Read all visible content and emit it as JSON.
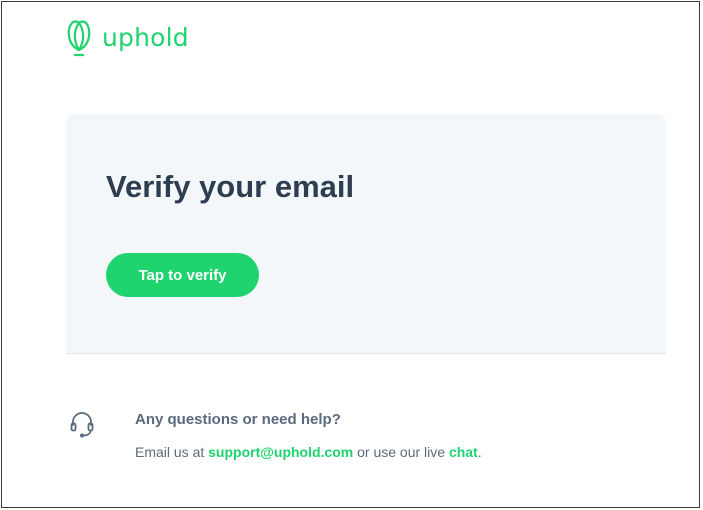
{
  "brand": {
    "name": "uphold",
    "color": "#1fd36f",
    "logo_icon": "uphold-leaf-icon"
  },
  "card": {
    "title": "Verify your email",
    "button_label": "Tap to verify",
    "background": "#f4f7fa",
    "title_color": "#2f3d51"
  },
  "help": {
    "icon": "headset-icon",
    "title": "Any questions or need help?",
    "text_prefix": "Email us at ",
    "email": "support@uphold.com",
    "text_middle": " or use our live ",
    "chat_label": "chat",
    "text_suffix": ".",
    "text_color": "#5a6b7d"
  }
}
